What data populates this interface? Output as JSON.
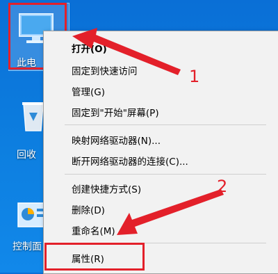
{
  "desktop": {
    "icons": [
      {
        "label": "此电",
        "name": "this-pc"
      },
      {
        "label": "回收",
        "name": "recycle-bin"
      },
      {
        "label": "控制面",
        "name": "control-panel"
      }
    ]
  },
  "menu": {
    "items": [
      {
        "label": "打开(O)"
      },
      {
        "label": "固定到快速访问"
      },
      {
        "label": "管理(G)"
      },
      {
        "label": "固定到\"开始\"屏幕(P)"
      },
      {
        "label": "映射网络驱动器(N)..."
      },
      {
        "label": "断开网络驱动器的连接(C)..."
      },
      {
        "label": "创建快捷方式(S)"
      },
      {
        "label": "删除(D)"
      },
      {
        "label": "重命名(M)"
      },
      {
        "label": "属性(R)"
      }
    ]
  },
  "annotations": {
    "step1": "1",
    "step2": "2",
    "color": "#e3202a"
  }
}
